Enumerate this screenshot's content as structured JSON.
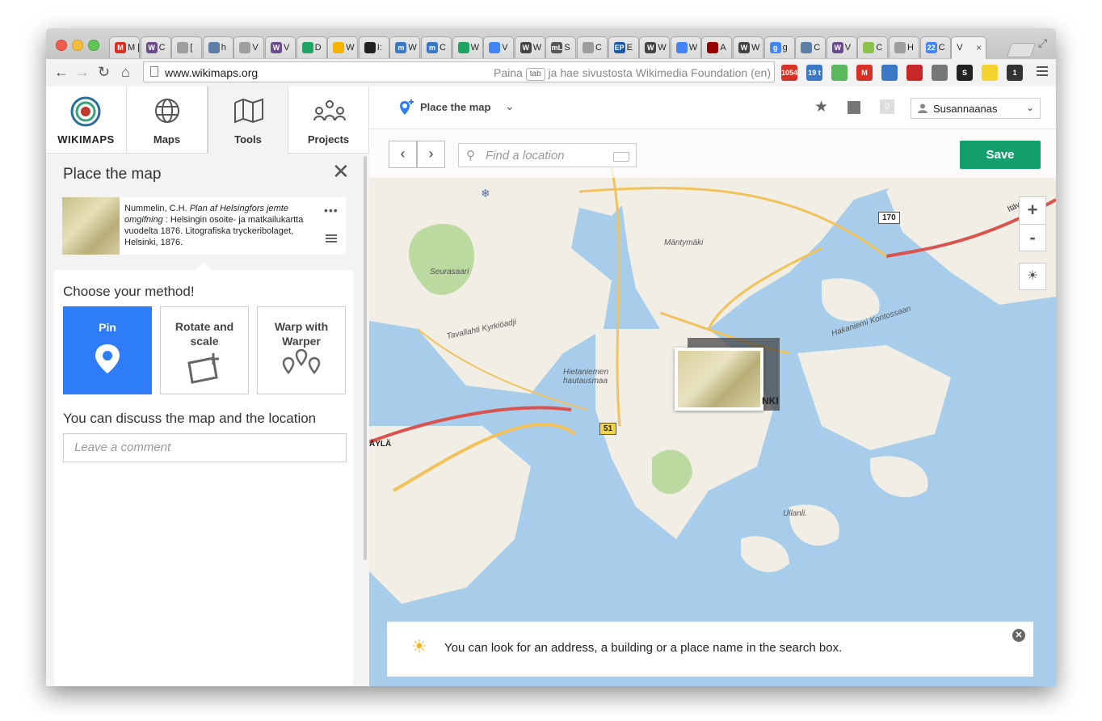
{
  "browser": {
    "tabs": [
      {
        "label": "M [",
        "color": "#d93025",
        "glyph": "M"
      },
      {
        "label": "C",
        "color": "#6a4b8c",
        "glyph": "W"
      },
      {
        "label": "[",
        "color": "#9e9e9e",
        "glyph": ""
      },
      {
        "label": "h",
        "color": "#5b7fa6",
        "glyph": ""
      },
      {
        "label": "V",
        "color": "#9e9e9e",
        "glyph": ""
      },
      {
        "label": "V",
        "color": "#6a4b8c",
        "glyph": "W"
      },
      {
        "label": "D",
        "color": "#1fa463",
        "glyph": ""
      },
      {
        "label": "W",
        "color": "#f4b400",
        "glyph": ""
      },
      {
        "label": "I:",
        "color": "#222222",
        "glyph": ""
      },
      {
        "label": "W",
        "color": "#3b78c5",
        "glyph": "m"
      },
      {
        "label": "C",
        "color": "#3b78c5",
        "glyph": "m"
      },
      {
        "label": "W",
        "color": "#1fa463",
        "glyph": ""
      },
      {
        "label": "V",
        "color": "#4285f4",
        "glyph": ""
      },
      {
        "label": "W",
        "color": "#444444",
        "glyph": "W"
      },
      {
        "label": "S",
        "color": "#555555",
        "glyph": "mL"
      },
      {
        "label": "C",
        "color": "#9e9e9e",
        "glyph": ""
      },
      {
        "label": "E",
        "color": "#1a5aa6",
        "glyph": "EP"
      },
      {
        "label": "W",
        "color": "#444444",
        "glyph": "W"
      },
      {
        "label": "W",
        "color": "#4285f4",
        "glyph": ""
      },
      {
        "label": "A",
        "color": "#990000",
        "glyph": ""
      },
      {
        "label": "W",
        "color": "#444444",
        "glyph": "W"
      },
      {
        "label": "g",
        "color": "#4285f4",
        "glyph": "g"
      },
      {
        "label": "C",
        "color": "#5b7fa6",
        "glyph": ""
      },
      {
        "label": "V",
        "color": "#6a4b8c",
        "glyph": "W"
      },
      {
        "label": "C",
        "color": "#8bc34a",
        "glyph": ""
      },
      {
        "label": "H",
        "color": "#9e9e9e",
        "glyph": ""
      },
      {
        "label": "C",
        "color": "#4285f4",
        "glyph": "22"
      },
      {
        "label": "V",
        "color": "#ffffff",
        "glyph": ""
      }
    ],
    "active_close": "×",
    "url": "www.wikimaps.org",
    "hint_pre": "Paina",
    "hint_key": "tab",
    "hint_post": "ja hae sivustosta Wikimedia Foundation (en)",
    "extensions": [
      {
        "name": "gmail-icon",
        "color": "#d93025",
        "text": "1054"
      },
      {
        "name": "calendar-icon",
        "color": "#3b78c5",
        "text": "19 t"
      },
      {
        "name": "refresh-green-icon",
        "color": "#5cb85c",
        "text": ""
      },
      {
        "name": "gmail-small-icon",
        "color": "#d93025",
        "text": "M"
      },
      {
        "name": "screen-icon",
        "color": "#3b78c5",
        "text": ""
      },
      {
        "name": "puzzle-icon",
        "color": "#c62828",
        "text": ""
      },
      {
        "name": "tag-icon",
        "color": "#777777",
        "text": ""
      },
      {
        "name": "stamp-icon",
        "color": "#222222",
        "text": "S"
      },
      {
        "name": "yellow-icon",
        "color": "#f5d22e",
        "text": ""
      },
      {
        "name": "dark-circle-icon",
        "color": "#333333",
        "text": "1"
      }
    ]
  },
  "nav": {
    "logo_label": "WIKIMAPS",
    "tabs": [
      "Maps",
      "Tools",
      "Projects"
    ]
  },
  "panel": {
    "title": "Place the map",
    "close": "✕",
    "citation_author": "Nummelin, C.H.",
    "citation_title": "Plan af Helsingfors jemte omgifning",
    "citation_rest": ": Helsingin osoite- ja matkailukartta vuodelta 1876. Litografiska tryckeribolaget, Helsinki, 1876.",
    "more": "•••",
    "method_title": "Choose your method!",
    "methods": [
      "Pin",
      "Rotate and scale",
      "Warp with Warper"
    ],
    "discuss_label": "You can discuss the map and the location",
    "comment_placeholder": "Leave a comment"
  },
  "maptop": {
    "place_label": "Place the map",
    "count": "0",
    "user": "Susannaanas"
  },
  "map": {
    "search_placeholder": "Find a location",
    "save_label": "Save",
    "zoom_in": "+",
    "zoom_out": "-",
    "labels": [
      "Mäntymäki",
      "Seurasaari",
      "Hietaniemen hautausmaa",
      "Ullanli.",
      "Tavallahti Kyrkiöadji",
      "Hakaniemi Kontossaan",
      "NKI",
      "ÄYLÄ",
      "Itäv"
    ],
    "roads": [
      "170",
      "51"
    ],
    "info_text": "You can look for an address, a building or a place name in the search box."
  },
  "colors": {
    "accent_blue": "#2f7df6",
    "save_green": "#13a06c",
    "water": "#a8cdeb",
    "land": "#f1eee6"
  }
}
